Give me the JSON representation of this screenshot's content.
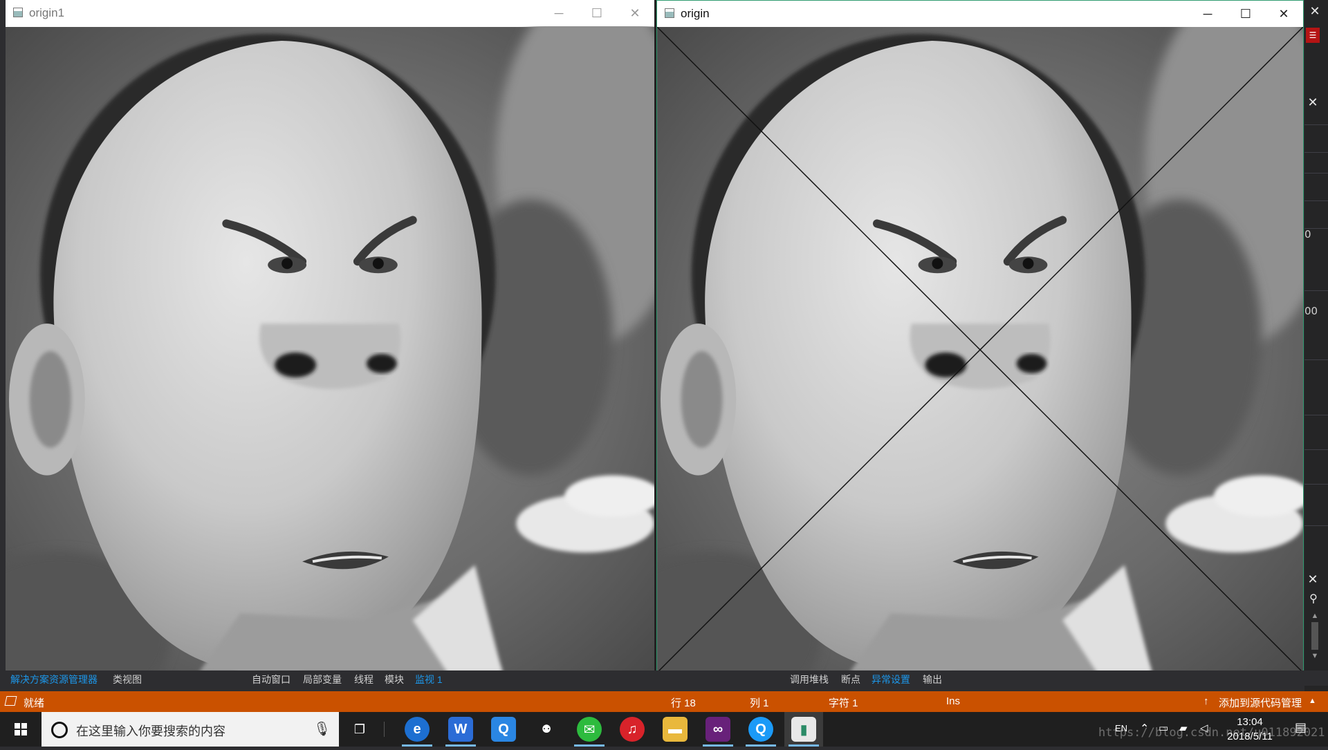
{
  "windows": {
    "left": {
      "title": "origin1",
      "minimize_icon": "minimize-icon",
      "maximize_icon": "maximize-icon",
      "close_icon": "close-icon"
    },
    "right": {
      "title": "origin",
      "minimize_icon": "minimize-icon",
      "maximize_icon": "maximize-icon",
      "close_icon": "close-icon"
    }
  },
  "ide": {
    "right_gutter_numbers": [
      "0",
      "00"
    ],
    "bottom_tabs_left": [
      "解决方案资源管理器",
      "类视图"
    ],
    "bottom_tabs_mid": [
      "自动窗口",
      "局部变量",
      "线程",
      "模块",
      "监视 1"
    ],
    "bottom_tabs_right": [
      "调用堆栈",
      "断点",
      "异常设置",
      "输出"
    ],
    "active_tab_color": "#1c97ea"
  },
  "statusbar": {
    "state": "就绪",
    "line": "行 18",
    "col": "列 1",
    "char": "字符 1",
    "mode": "Ins",
    "source_control": "添加到源代码管理",
    "color": "#ca5100"
  },
  "taskbar": {
    "search_placeholder": "在这里输入你要搜索的内容",
    "apps": [
      "edge-icon",
      "wps-writer-icon",
      "qq-browser-icon",
      "network-icon",
      "wechat-icon",
      "netease-music-icon",
      "file-explorer-icon",
      "visual-studio-icon",
      "qq-icon",
      "opencv-window-icon"
    ],
    "tray_lang": "EN",
    "time": "13:04",
    "date": "2018/5/11",
    "watermark": "https://blog.csdn.net/u011892021"
  }
}
